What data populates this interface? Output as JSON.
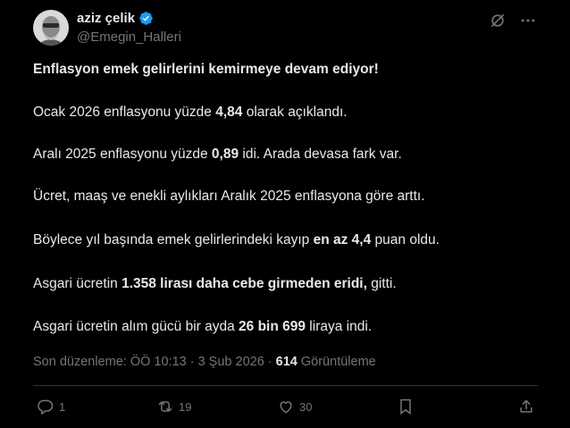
{
  "user": {
    "display_name": "aziz çelik",
    "handle": "@Emegin_Halleri"
  },
  "tweet": {
    "headline": "Enflasyon emek gelirlerini kemirmeye devam ediyor!",
    "p1": {
      "a": "Ocak 2026 enflasyonu yüzde ",
      "b": "4,84",
      "c": " olarak açıklandı."
    },
    "p2": {
      "a": "Aralı 2025 enflasyonu yüzde ",
      "b": "0,89",
      "c": " idi.  Arada devasa fark var."
    },
    "p3": {
      "a": "Ücret, maaş ve enekli aylıkları Aralık 2025 enflasyona göre arttı."
    },
    "p4": {
      "a": "Böylece yıl başında emek gelirlerindeki kayıp ",
      "b": "en az 4,4",
      "c": " puan oldu."
    },
    "p5": {
      "a": "Asgari ücretin  ",
      "b": "1.358 lirası daha cebe girmeden eridi,",
      "c": " gitti."
    },
    "p6": {
      "a": "Asgari ücretin alım gücü bir ayda ",
      "b": "26 bin 699",
      "c": " liraya indi."
    }
  },
  "meta": {
    "edited_text": "Son düzenleme: ÖÖ 10:13 · 3 Şub 2026 · ",
    "views_count": "614",
    "views_label": " Görüntüleme"
  },
  "actions": {
    "replies": "1",
    "reposts": "19",
    "likes": "30"
  },
  "colors": {
    "background": "#000000",
    "text": "#e7e9ea",
    "secondary": "#71767b",
    "verified": "#1d9bf0",
    "divider": "#2f3336"
  }
}
